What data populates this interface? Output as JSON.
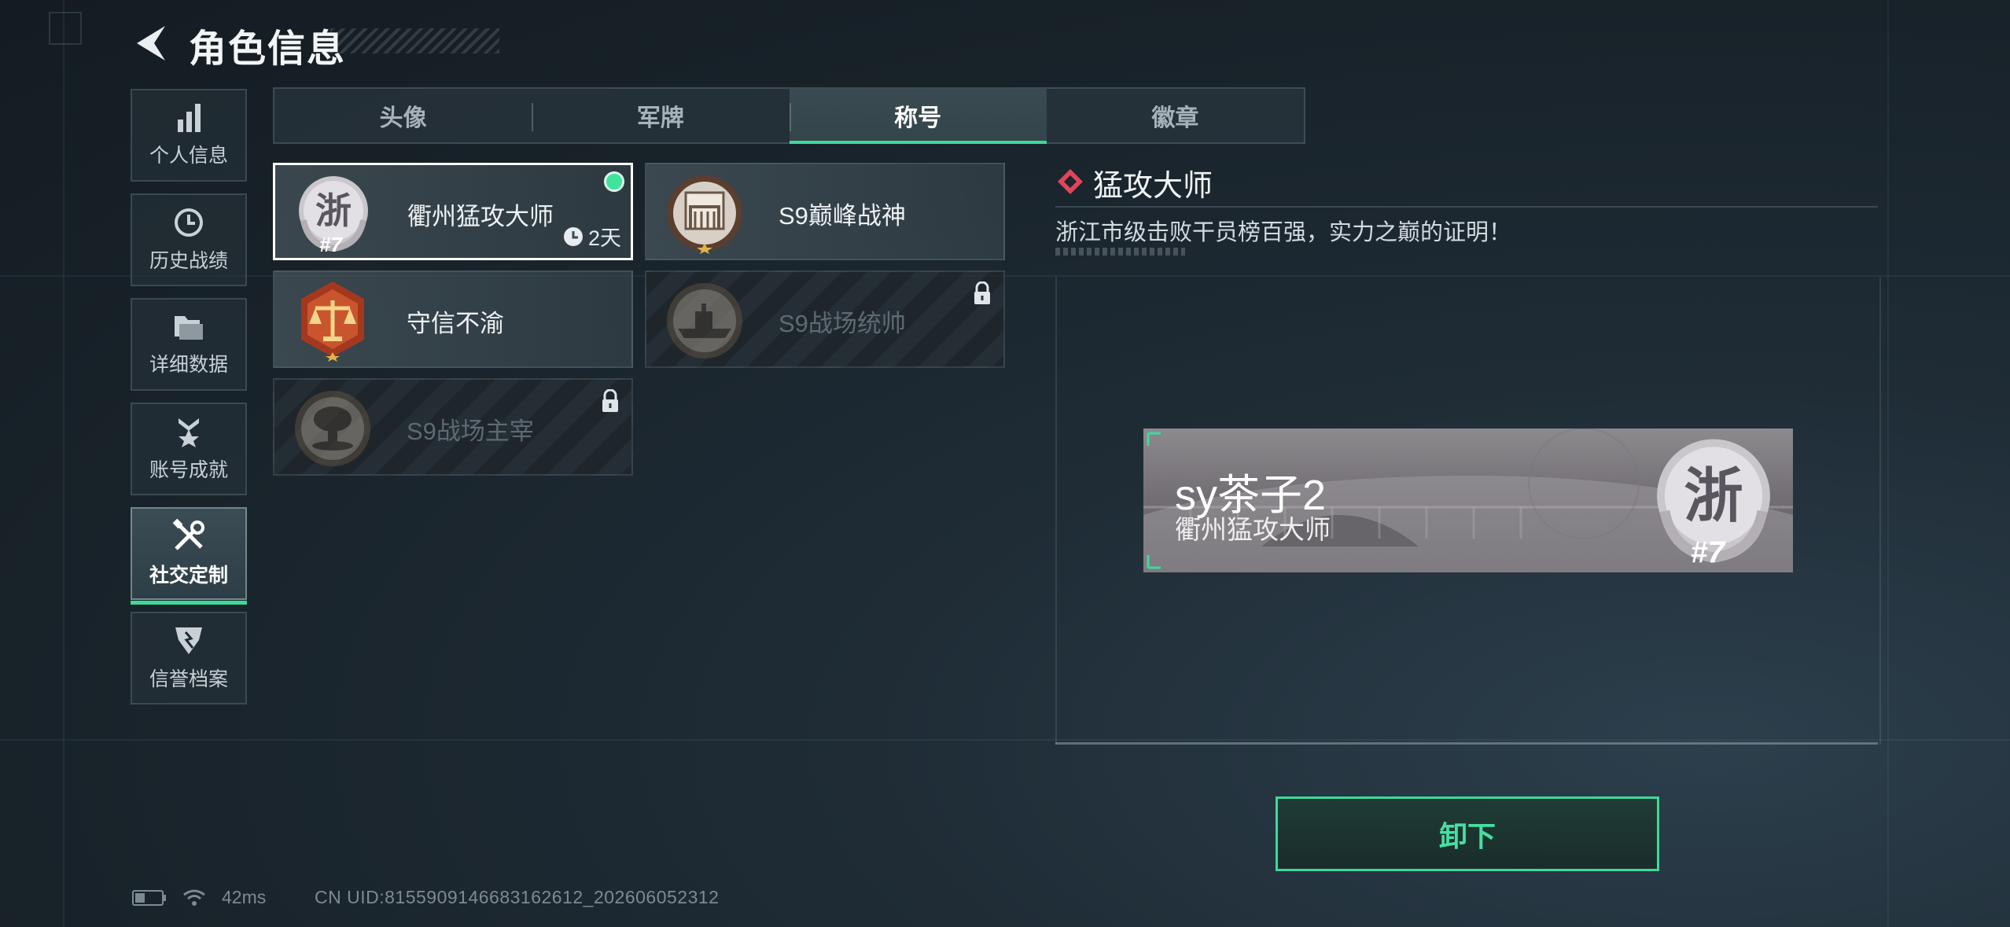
{
  "header": {
    "title": "角色信息"
  },
  "sidebar": {
    "items": [
      {
        "label": "个人信息",
        "icon": "bar-chart-icon",
        "active": false
      },
      {
        "label": "历史战绩",
        "icon": "history-clock-icon",
        "active": false
      },
      {
        "label": "详细数据",
        "icon": "folder-icon",
        "active": false
      },
      {
        "label": "账号成就",
        "icon": "achievement-medal-icon",
        "active": false
      },
      {
        "label": "社交定制",
        "icon": "tools-icon",
        "active": true
      },
      {
        "label": "信誉档案",
        "icon": "credit-shield-icon",
        "active": false
      }
    ]
  },
  "tabs": [
    {
      "label": "头像",
      "active": false
    },
    {
      "label": "军牌",
      "active": false
    },
    {
      "label": "称号",
      "active": true
    },
    {
      "label": "徽章",
      "active": false
    }
  ],
  "titles": [
    {
      "name": "衢州猛攻大师",
      "emblem": "zhe-rank-7-emblem",
      "emblem_char": "浙",
      "rank": "#7",
      "selected": true,
      "equipped": true,
      "timer": "2天",
      "locked": false
    },
    {
      "name": "S9巅峰战神",
      "emblem": "gate-star-emblem",
      "selected": false,
      "equipped": false,
      "locked": false
    },
    {
      "name": "守信不渝",
      "emblem": "scales-emblem",
      "selected": false,
      "equipped": false,
      "locked": false
    },
    {
      "name": "S9战场统帅",
      "emblem": "warship-emblem",
      "selected": false,
      "equipped": false,
      "locked": true
    },
    {
      "name": "S9战场主宰",
      "emblem": "mushroom-cloud-emblem",
      "selected": false,
      "equipped": false,
      "locked": true
    }
  ],
  "detail": {
    "title": "猛攻大师",
    "description": "浙江市级击败干员榜百强，实力之巅的证明！"
  },
  "banner": {
    "player_name": "sy茶子2",
    "title": "衢州猛攻大师",
    "emblem_char": "浙",
    "rank": "#7"
  },
  "action": {
    "label": "卸下"
  },
  "status": {
    "ping": "42ms",
    "uid": "CN UID:8155909146683162612_202606052312"
  },
  "colors": {
    "accent": "#3fd89a",
    "background": "#1b252c",
    "selected_border": "#ffffff",
    "diamond": "#e0455a"
  }
}
